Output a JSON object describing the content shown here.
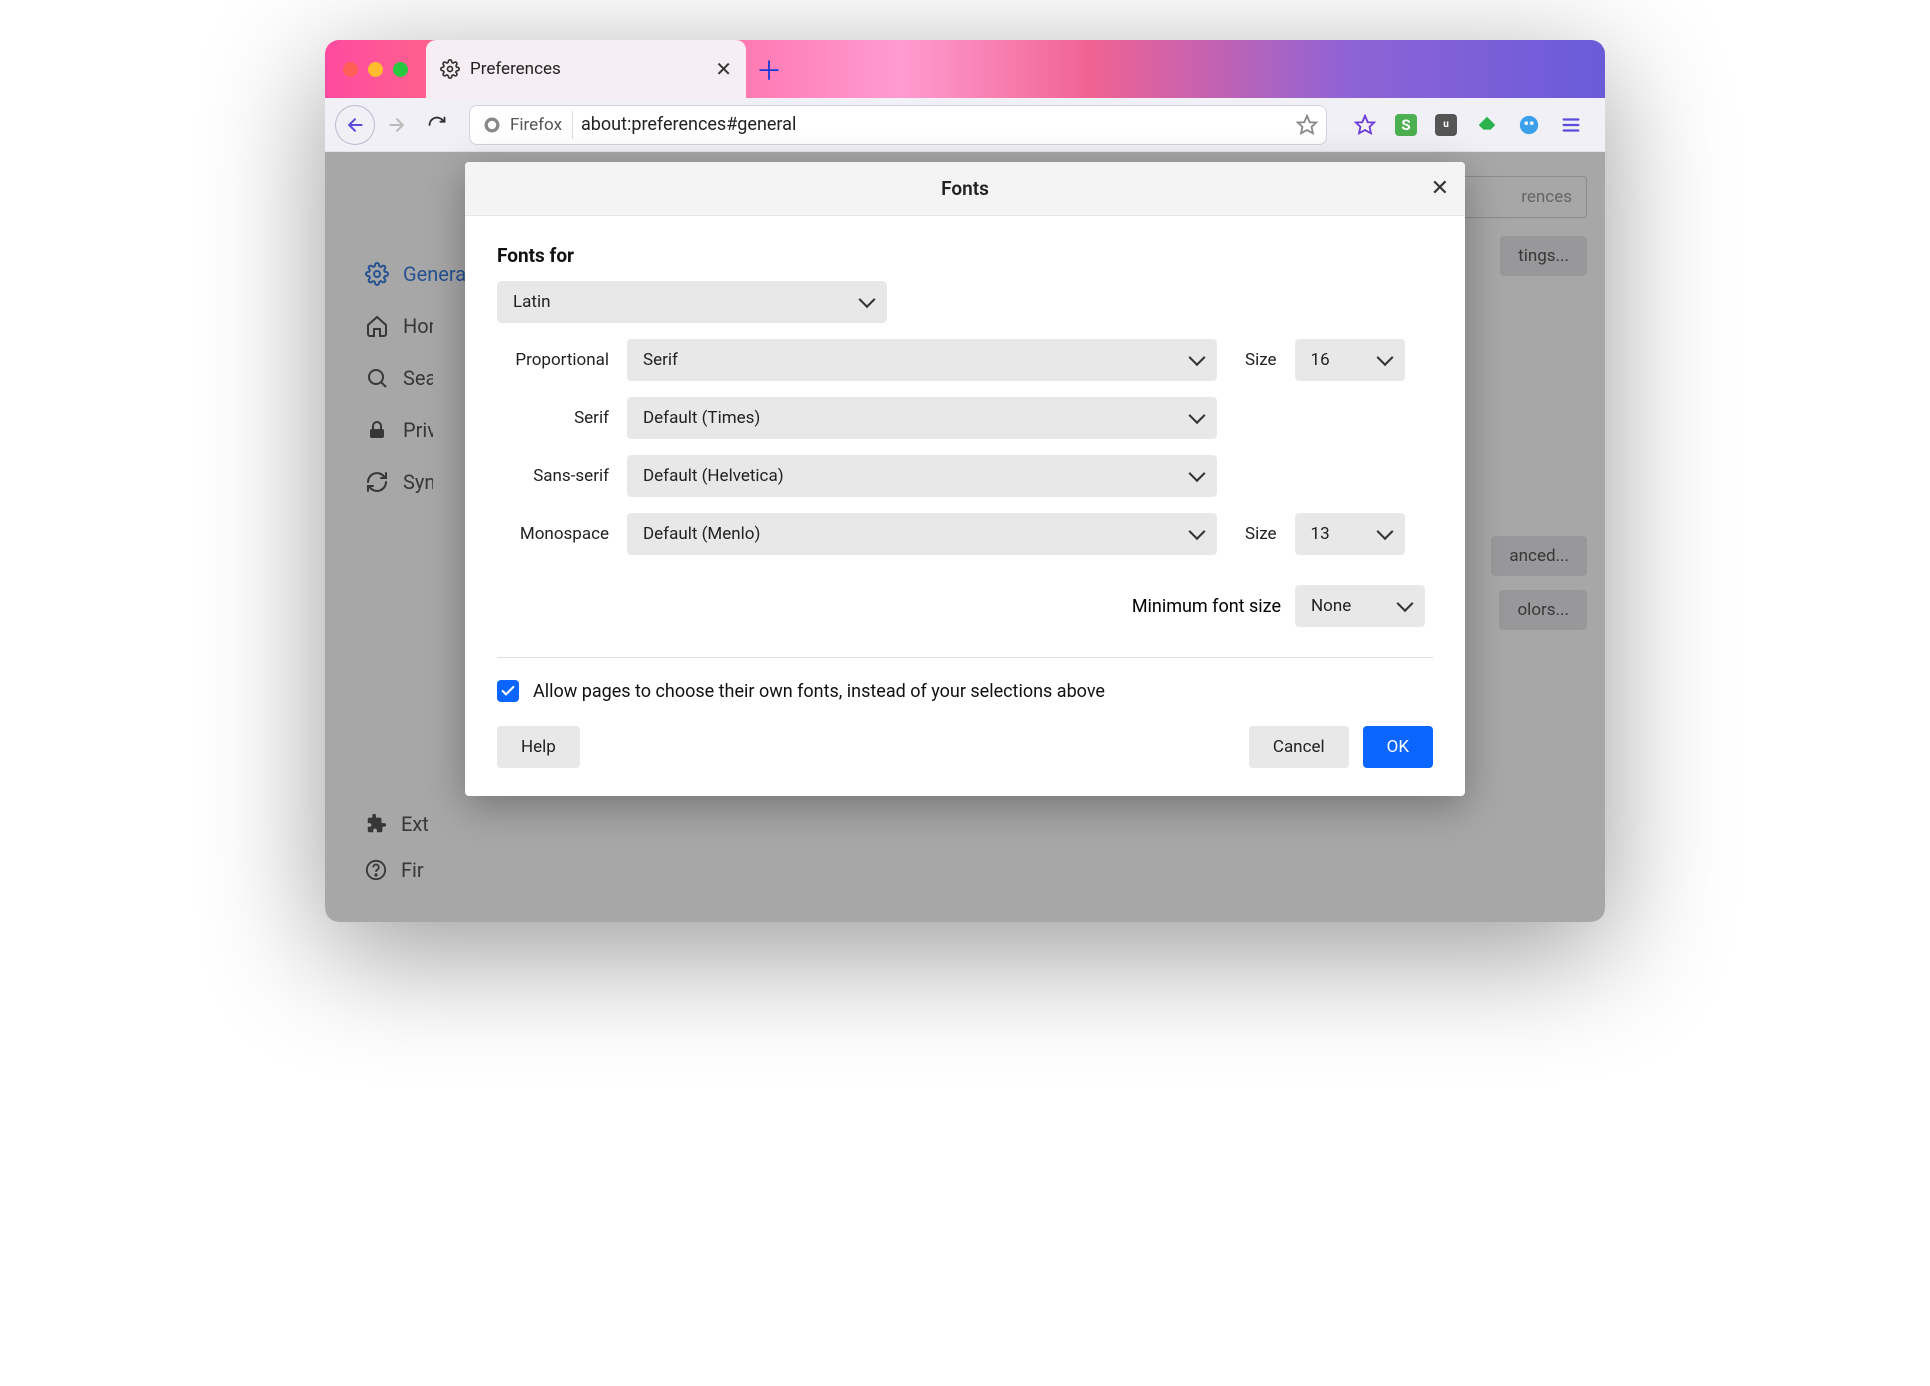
{
  "tab": {
    "title": "Preferences"
  },
  "urlbar": {
    "identity": "Firefox",
    "url": "about:preferences#general"
  },
  "sidebar": {
    "items": [
      {
        "label": "General",
        "icon": "gear"
      },
      {
        "label": "Home",
        "icon": "home"
      },
      {
        "label": "Search",
        "icon": "search"
      },
      {
        "label": "Privacy",
        "icon": "lock"
      },
      {
        "label": "Sync",
        "icon": "sync"
      }
    ],
    "bottom": [
      {
        "label": "Extensions"
      },
      {
        "label": "Firefox"
      }
    ]
  },
  "background": {
    "search_placeholder": "rences",
    "buttons": [
      "tings...",
      "anced...",
      "olors..."
    ]
  },
  "modal": {
    "title": "Fonts",
    "fonts_for_label": "Fonts for",
    "script_select": "Latin",
    "rows": {
      "proportional": {
        "label": "Proportional",
        "value": "Serif",
        "size_label": "Size",
        "size": "16"
      },
      "serif": {
        "label": "Serif",
        "value": "Default (Times)"
      },
      "sans": {
        "label": "Sans-serif",
        "value": "Default (Helvetica)"
      },
      "mono": {
        "label": "Monospace",
        "value": "Default (Menlo)",
        "size_label": "Size",
        "size": "13"
      }
    },
    "min_font_label": "Minimum font size",
    "min_font_value": "None",
    "allow_pages_label": "Allow pages to choose their own fonts, instead of your selections above",
    "allow_pages_checked": true,
    "help": "Help",
    "cancel": "Cancel",
    "ok": "OK"
  }
}
